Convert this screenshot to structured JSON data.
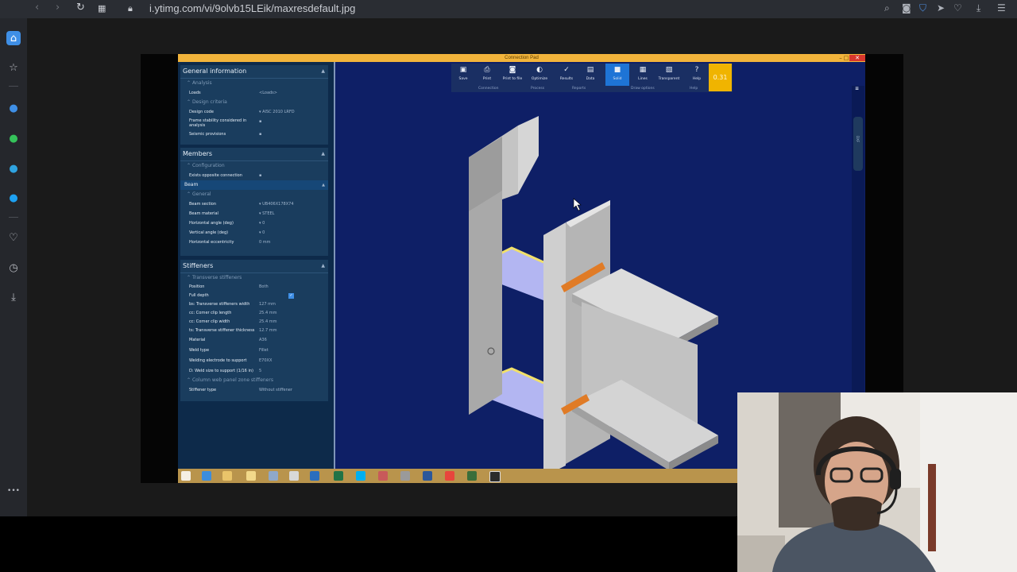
{
  "browser": {
    "url": "i.ytimg.com/vi/9olvb15LEik/maxresdefault.jpg",
    "nav_icons": [
      "back-icon",
      "forward-icon",
      "reload-icon",
      "grid-icon",
      "lock-icon"
    ],
    "toolbar_icons": [
      "search-icon",
      "camera-icon",
      "shield-icon",
      "send-icon",
      "heart-icon",
      "download-icon",
      "settings-icon"
    ]
  },
  "sidebar": {
    "icons": [
      "home-icon",
      "star-icon",
      "messenger-icon",
      "whatsapp-icon",
      "telegram-icon",
      "twitter-icon",
      "heart-icon",
      "clock-icon",
      "download-icon",
      "more-icon"
    ],
    "more_label": "•••"
  },
  "app": {
    "title": "Connection Pad",
    "window_buttons": {
      "minimize": "–",
      "maximize": "□",
      "close": "✕"
    },
    "sections": {
      "general": {
        "title": "General information",
        "analysis_label": "Analysis",
        "rows": [
          {
            "k": "Loads",
            "v": "<Loads>"
          }
        ],
        "criteria_label": "Design criteria",
        "rows2": [
          {
            "k": "Design code",
            "v": "AISC 2010 LRFD"
          },
          {
            "k": "Frame stability considered in analysis",
            "v": ""
          },
          {
            "k": "Seismic provisions",
            "v": ""
          }
        ]
      },
      "members": {
        "title": "Members",
        "config_label": "Configuration",
        "rows": [
          {
            "k": "Exists opposite connection",
            "v": ""
          }
        ],
        "beam_label": "Beam",
        "general_label": "General",
        "rows2": [
          {
            "k": "Beam section",
            "v": "UB406X178X74"
          },
          {
            "k": "Beam material",
            "v": "STEEL"
          },
          {
            "k": "Horizontal angle (deg)",
            "v": "0"
          },
          {
            "k": "Vertical angle (deg)",
            "v": "0"
          },
          {
            "k": "Horizontal eccentricity",
            "v": "0 mm"
          }
        ]
      },
      "stiffeners": {
        "title": "Stiffeners",
        "transverse_label": "Transverse stiffeners",
        "rows": [
          {
            "k": "Position",
            "v": "Both"
          },
          {
            "k": "Full depth",
            "v": ""
          },
          {
            "k": "bs: Transverse stiffeners width",
            "v": "127 mm"
          },
          {
            "k": "cc: Corner clip length",
            "v": "25.4 mm"
          },
          {
            "k": "cc: Corner clip width",
            "v": "25.4 mm"
          },
          {
            "k": "ts: Transverse stiffener thickness",
            "v": "12.7 mm"
          },
          {
            "k": "Material",
            "v": "A36"
          },
          {
            "k": "Weld type",
            "v": "Fillet"
          },
          {
            "k": "Welding electrode to support",
            "v": "E70XX"
          },
          {
            "k": "D: Weld size to support (1/16 in)",
            "v": "5"
          }
        ],
        "panel_label": "Column web panel zone stiffeners",
        "rows2": [
          {
            "k": "Stiffener type",
            "v": "Without stiffener"
          }
        ]
      }
    },
    "toolbar": {
      "buttons": [
        {
          "label": "Save",
          "icon": "save-icon",
          "glyph": "▣"
        },
        {
          "label": "Print",
          "icon": "print-icon",
          "glyph": "⎙"
        },
        {
          "label": "Print to file",
          "icon": "camera-icon",
          "glyph": "◙"
        },
        {
          "label": "Optimize",
          "icon": "optimize-icon",
          "glyph": "◐"
        },
        {
          "label": "Results",
          "icon": "results-icon",
          "glyph": "✓"
        },
        {
          "label": "Data",
          "icon": "data-icon",
          "glyph": "▤"
        },
        {
          "label": "Solid",
          "icon": "solid-icon",
          "glyph": "■"
        },
        {
          "label": "Lines",
          "icon": "lines-icon",
          "glyph": "▦"
        },
        {
          "label": "Transparent",
          "icon": "transparent-icon",
          "glyph": "▧"
        },
        {
          "label": "Help",
          "icon": "help-icon",
          "glyph": "?"
        }
      ],
      "groups": [
        "Connection",
        "Process",
        "Reports",
        "Draw options",
        "Help"
      ]
    },
    "ratio": "0.31",
    "side_tab": "DXF",
    "colors": {
      "accent": "#f0b400",
      "viewport": "#0e1f66",
      "steel": "#b4b4b4",
      "stiffener": "#b3b6f2",
      "weld": "#e07b26"
    }
  }
}
